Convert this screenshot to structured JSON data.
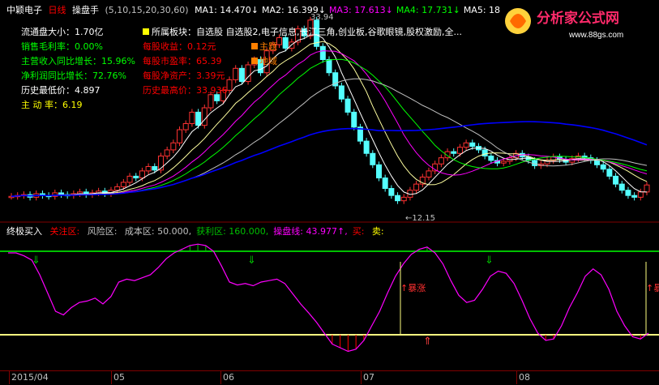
{
  "header": {
    "stock_name": "中颖电子",
    "period": "日线",
    "indicator": "操盘手",
    "params": "(5,10,15,20,30,60)",
    "ma": [
      {
        "label": "MA1:",
        "value": "14.470",
        "arrow": "↓",
        "color": "#ffffff"
      },
      {
        "label": "MA2:",
        "value": "16.399",
        "arrow": "↓",
        "color": "#ffffff"
      },
      {
        "label": "MA3:",
        "value": "17.613",
        "arrow": "↓",
        "color": "#ff00ff"
      },
      {
        "label": "MA4:",
        "value": "17.731",
        "arrow": "↓",
        "color": "#00ff00"
      },
      {
        "label": "MA5:",
        "value": "18",
        "arrow": "",
        "color": "#ffffff"
      }
    ]
  },
  "logo": {
    "text": "分析家公式网",
    "url": "www.88gs.com"
  },
  "info_left": [
    {
      "label": "流通盘大小：",
      "value": "1.70亿",
      "color": "#ffffff"
    },
    {
      "label": "销售毛利率：",
      "value": "0.00%",
      "color": "#00ff00"
    },
    {
      "label": "主营收入同比增长：",
      "value": "15.96%",
      "color": "#00ff00"
    },
    {
      "label": "净利润同比增长：",
      "value": "72.76%",
      "color": "#00ff00"
    },
    {
      "label": "历史最低价：",
      "value": "4.897",
      "color": "#ffffff"
    },
    {
      "label": "主 动 率：",
      "value": "6.19",
      "color": "#ffff00"
    }
  ],
  "info_right": [
    {
      "label": "所属板块：",
      "value": "自选股 自选股2,电子信息,长江三角,创业板,谷歌眼镜,股权激励,全...",
      "color": "#ffffff"
    },
    {
      "label": "每股收益：",
      "value": "0.12元",
      "color": "#ff0000"
    },
    {
      "label": "每股市盈率：",
      "value": "65.39",
      "color": "#ff0000"
    },
    {
      "label": "每股净资产：",
      "value": "3.39元",
      "color": "#ff0000"
    },
    {
      "label": "历史最高价：",
      "value": "33.936",
      "color": "#ff0000"
    }
  ],
  "tags": [
    {
      "text": "主题",
      "color": "#ff8000"
    },
    {
      "text": "地域",
      "color": "#ff8000"
    }
  ],
  "price_marks": {
    "high": "33.94",
    "low": "12.15"
  },
  "sub_header": {
    "title": "终极买入",
    "items": [
      {
        "label": "关注区:",
        "value": "",
        "color": "#ff0000"
      },
      {
        "label": "风险区:",
        "value": "",
        "color": "#c0c0c0"
      },
      {
        "label": "成本区:",
        "value": "50.000,",
        "color": "#c0c0c0"
      },
      {
        "label": "获利区:",
        "value": "160.000,",
        "color": "#00c000"
      },
      {
        "label": "操盘线:",
        "value": "43.977↑,",
        "color": "#ff00ff"
      },
      {
        "label": "买:",
        "value": "",
        "color": "#ff0000"
      },
      {
        "label": "卖:",
        "value": "",
        "color": "#ffff00"
      }
    ]
  },
  "signals": {
    "surge": "暴涨",
    "surge2": "暴"
  },
  "time_axis": [
    "2015/04",
    "05",
    "06",
    "07",
    "08"
  ],
  "colors": {
    "up": "#ff3232",
    "down": "#54ffff",
    "frame": "#800000",
    "ma_blue": "#0000ff"
  }
}
